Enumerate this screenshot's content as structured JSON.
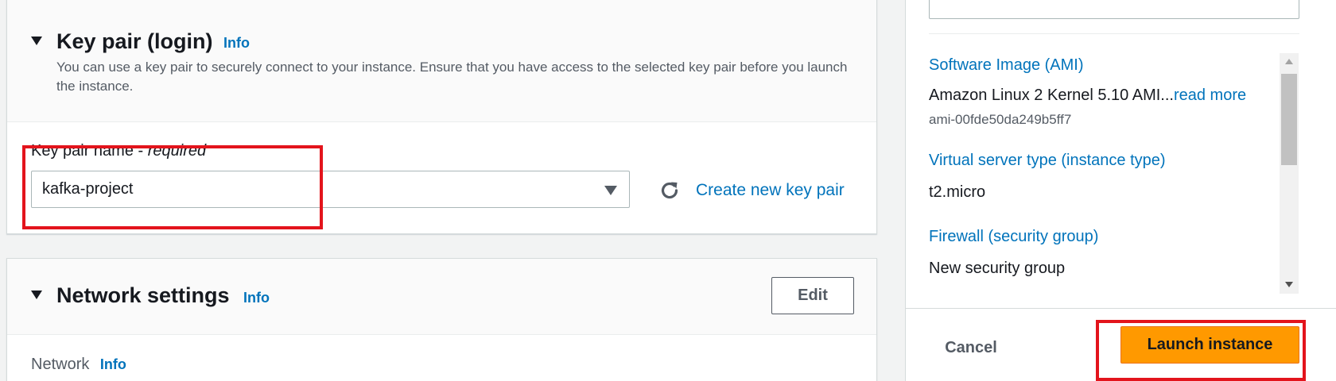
{
  "key_pair_section": {
    "title": "Key pair (login)",
    "info_label": "Info",
    "description": "You can use a key pair to securely connect to your instance. Ensure that you have access to the selected key pair before you launch the instance.",
    "field_label": "Key pair name - ",
    "field_required": "required",
    "selected_key_pair": "kafka-project",
    "create_link": "Create new key pair"
  },
  "network_section": {
    "title": "Network settings",
    "info_label": "Info",
    "edit_label": "Edit",
    "network_label": "Network",
    "network_info_label": "Info"
  },
  "summary": {
    "ami_link": "Software Image (AMI)",
    "ami_value": "Amazon Linux 2 Kernel 5.10 AMI...",
    "ami_read_more": "read more",
    "ami_id": "ami-00fde50da249b5ff7",
    "instance_type_link": "Virtual server type (instance type)",
    "instance_type_value": "t2.micro",
    "firewall_link": "Firewall (security group)",
    "firewall_value": "New security group",
    "cancel_label": "Cancel",
    "launch_label": "Launch instance"
  },
  "colors": {
    "link": "#0073bb",
    "primary_button": "#ff9900",
    "highlight": "#e3141c"
  }
}
